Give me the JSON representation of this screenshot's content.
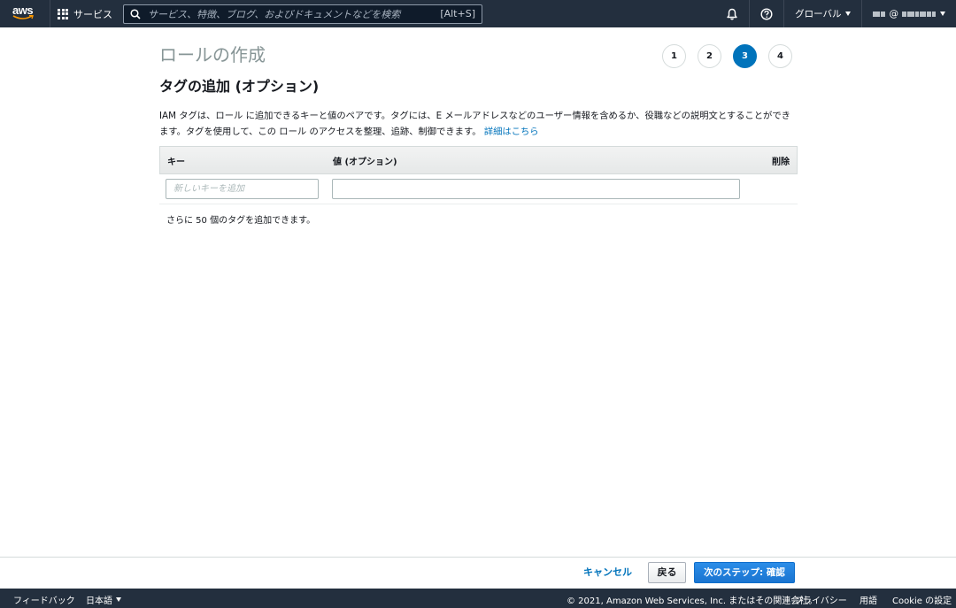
{
  "topnav": {
    "logo_text": "aws",
    "services_label": "サービス",
    "search_placeholder": "サービス、特徴、ブログ、およびドキュメントなどを検索",
    "search_shortcut": "[Alt+S]",
    "region_label": "グローバル",
    "account_separator": "@"
  },
  "page": {
    "title": "ロールの作成",
    "steps": [
      "1",
      "2",
      "3",
      "4"
    ],
    "active_step": "3",
    "section_title": "タグの追加 (オプション)",
    "description": "IAM タグは、ロール に追加できるキーと値のペアです。タグには、E メールアドレスなどのユーザー情報を含めるか、役職などの説明文とすることができます。タグを使用して、この ロール のアクセスを整理、追跡、制御できます。",
    "learn_more": "詳細はこちら"
  },
  "table": {
    "headers": {
      "key": "キー",
      "value": "値 (オプション)",
      "delete": "削除"
    },
    "key_placeholder": "新しいキーを追加",
    "value_value": "",
    "remaining": "さらに 50 個のタグを追加できます。"
  },
  "actions": {
    "cancel": "キャンセル",
    "back": "戻る",
    "next": "次のステップ: 確認"
  },
  "footer": {
    "feedback": "フィードバック",
    "language": "日本語",
    "copyright": "© 2021, Amazon Web Services, Inc. またはその関連会社。",
    "privacy": "プライバシー",
    "terms": "用語",
    "cookie": "Cookie の設定"
  },
  "colors": {
    "nav_bg": "#232f3e",
    "accent": "#0073bb",
    "primary_button": "#1a74d0"
  }
}
